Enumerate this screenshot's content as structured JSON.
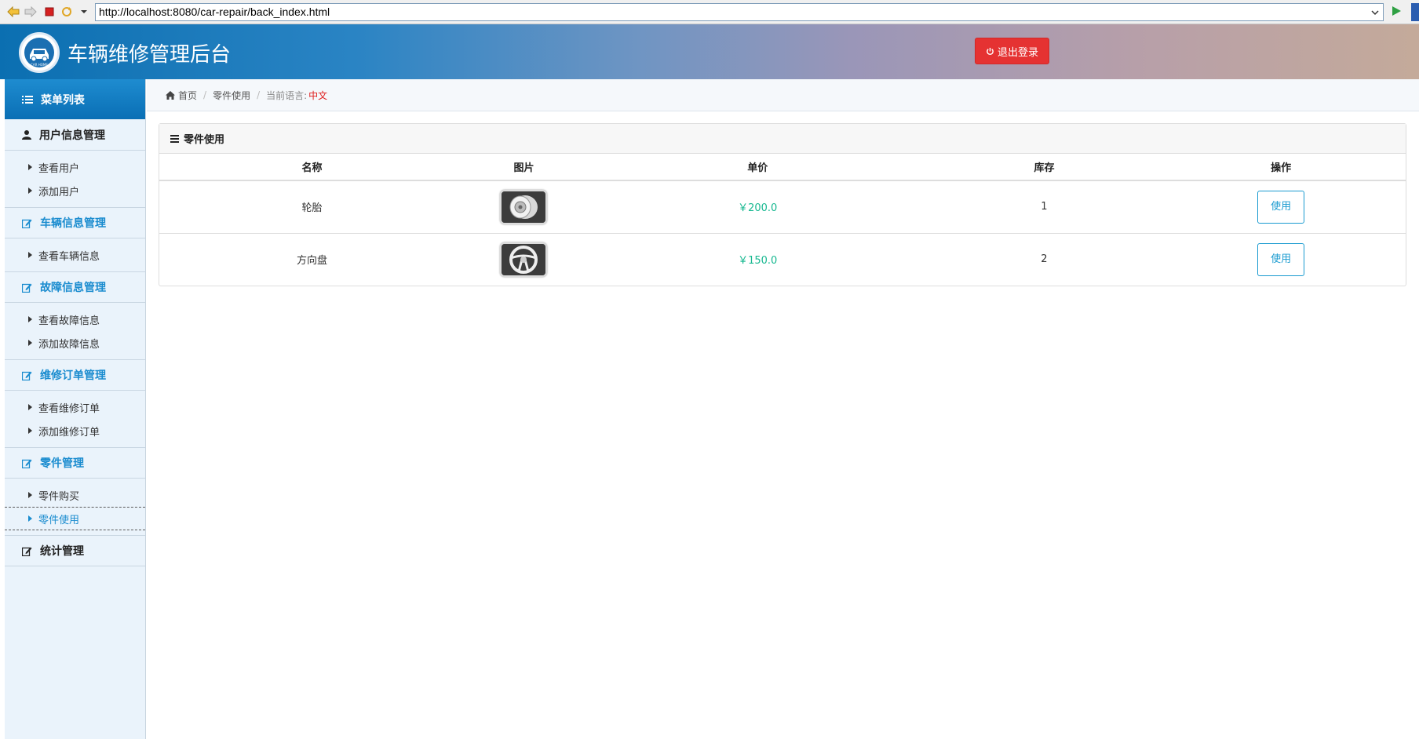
{
  "browser": {
    "url": "http://localhost:8080/car-repair/back_index.html"
  },
  "header": {
    "title": "车辆维修管理后台",
    "logo_text": "CAR HOME",
    "logout_label": "退出登录"
  },
  "sidebar": {
    "heading": "菜单列表",
    "groups": [
      {
        "title": "用户信息管理",
        "items": [
          "查看用户",
          "添加用户"
        ]
      },
      {
        "title": "车辆信息管理",
        "items": [
          "查看车辆信息"
        ]
      },
      {
        "title": "故障信息管理",
        "items": [
          "查看故障信息",
          "添加故障信息"
        ]
      },
      {
        "title": "维修订单管理",
        "items": [
          "查看维修订单",
          "添加维修订单"
        ]
      },
      {
        "title": "零件管理",
        "items": [
          "零件购买",
          "零件使用"
        ]
      },
      {
        "title": "统计管理",
        "items": []
      }
    ]
  },
  "breadcrumb": {
    "home": "首页",
    "current": "零件使用",
    "lang_label": "当前语言:",
    "lang_value": "中文"
  },
  "panel": {
    "title": "零件使用",
    "columns": [
      "名称",
      "图片",
      "单价",
      "库存",
      "操作"
    ],
    "rows": [
      {
        "name": "轮胎",
        "image": "tire-icon",
        "price": "￥200.0",
        "stock": "1",
        "action": "使用"
      },
      {
        "name": "方向盘",
        "image": "steering-wheel-icon",
        "price": "￥150.0",
        "stock": "2",
        "action": "使用"
      }
    ]
  },
  "colors": {
    "accent": "#1a8ccf",
    "danger": "#e53232",
    "price": "#17b890"
  }
}
